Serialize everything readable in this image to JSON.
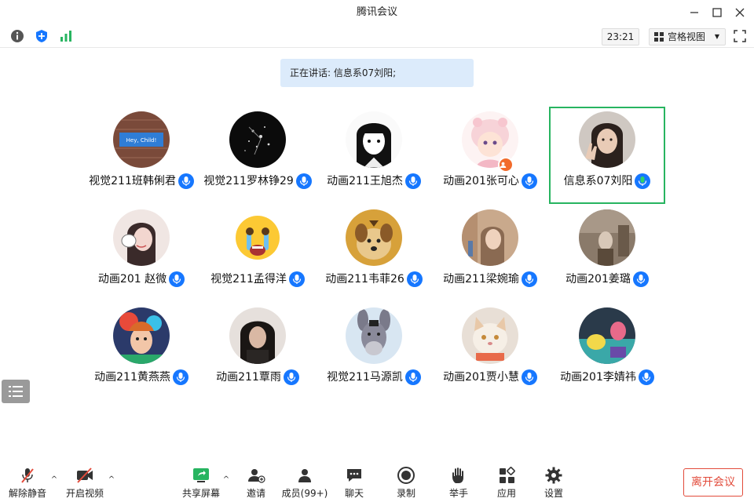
{
  "window": {
    "title": "腾讯会议"
  },
  "toolbar": {
    "time": "23:21",
    "view_label": "宫格视图"
  },
  "speaking_banner": "正在讲话: 信息系07刘阳;",
  "participants": [
    {
      "name": "视觉211班韩俐君",
      "avatar": "hey-child-sign",
      "mic": "on"
    },
    {
      "name": "视觉211罗林铮29",
      "avatar": "dark-sparkle",
      "mic": "on"
    },
    {
      "name": "动画211王旭杰",
      "avatar": "anime-girl-bw",
      "mic": "on"
    },
    {
      "name": "动画201张可心",
      "avatar": "pink-cartoon",
      "mic": "on",
      "host": true
    },
    {
      "name": "信息系07刘阳",
      "avatar": "girl-peace-sign",
      "mic": "speaking",
      "active": true
    },
    {
      "name": "动画201 赵微",
      "avatar": "illustrated-woman",
      "mic": "on"
    },
    {
      "name": "视觉211孟得洋",
      "avatar": "crying-emoji",
      "mic": "on"
    },
    {
      "name": "动画211韦菲26",
      "avatar": "dog-photo",
      "mic": "on"
    },
    {
      "name": "动画211梁婉瑜",
      "avatar": "portrait-photo",
      "mic": "on"
    },
    {
      "name": "动画201姜璐",
      "avatar": "vintage-photo",
      "mic": "on"
    },
    {
      "name": "动画211黄燕燕",
      "avatar": "colorful-art",
      "mic": "on"
    },
    {
      "name": "动画211覃雨",
      "avatar": "person-dark",
      "mic": "on"
    },
    {
      "name": "视觉211马源凯",
      "avatar": "donkey-cartoon",
      "mic": "on"
    },
    {
      "name": "动画201贾小慧",
      "avatar": "cat-photo",
      "mic": "on"
    },
    {
      "name": "动画201李婧祎",
      "avatar": "cartoon-scene",
      "mic": "on"
    }
  ],
  "bottom": {
    "unmute": "解除静音",
    "start_video": "开启视频",
    "share_screen": "共享屏幕",
    "invite": "邀请",
    "members": "成员(99+)",
    "chat": "聊天",
    "record": "录制",
    "raise_hand": "举手",
    "apps": "应用",
    "settings": "设置",
    "leave": "离开会议"
  },
  "colors": {
    "accent": "#1677ff",
    "speaking_green": "#27b460",
    "leave_red": "#e24b3b",
    "banner_bg": "#dcebfb"
  }
}
